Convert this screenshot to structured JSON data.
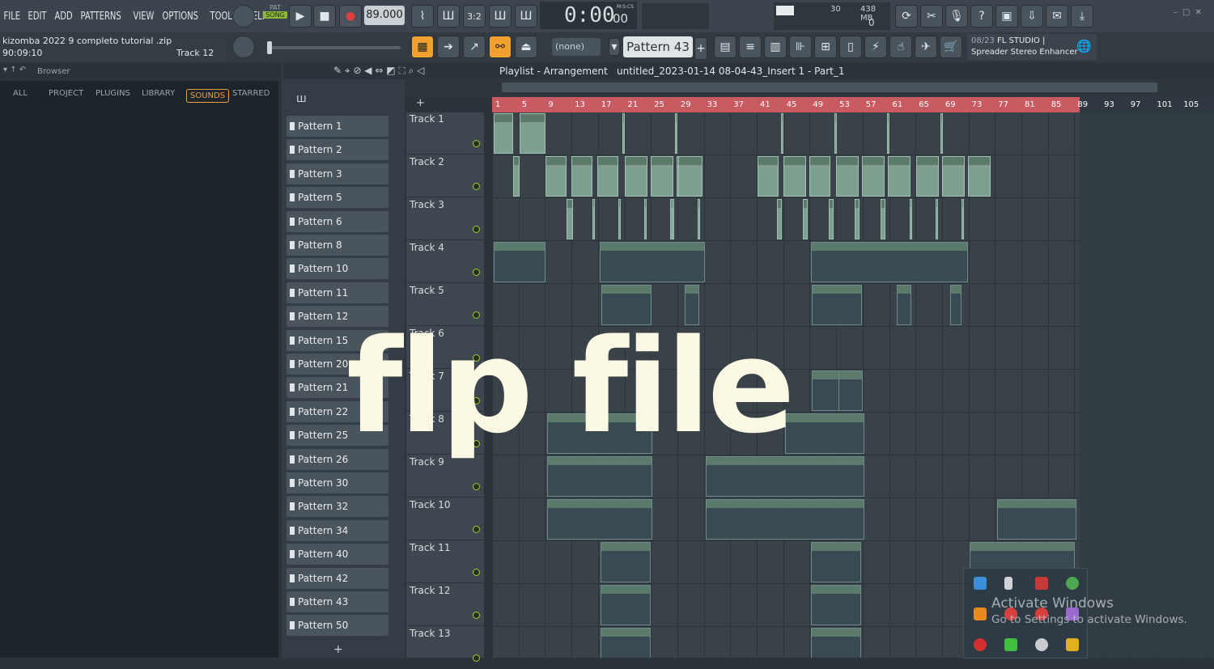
{
  "menu": [
    "FILE",
    "EDIT",
    "ADD",
    "PATTERNS",
    "VIEW",
    "OPTIONS",
    "TOOLS",
    "HELP"
  ],
  "transport": {
    "pat_label": "PAT",
    "song_label": "SONG",
    "tempo": "89.000",
    "time": "0:00",
    "time_small": "00",
    "time_unit": "M:S:CS"
  },
  "perf": {
    "cpu": "30",
    "mem": "438 MB",
    "poly": "0"
  },
  "hint": {
    "project": "kizomba 2022 9 completo  tutorial .zip",
    "time": "90:09:10",
    "target": "Track 12"
  },
  "pattern_select": {
    "none_label": "(none)",
    "pattern": "Pattern 43"
  },
  "news": {
    "date": "08/23",
    "title": "FL STUDIO |",
    "subtitle": "Spreader Stereo Enhancer"
  },
  "browser": {
    "title": "Browser",
    "tabs": [
      "ALL",
      "PROJECT",
      "PLUGINS",
      "LIBRARY",
      "SOUNDS",
      "STARRED"
    ],
    "active_tab": "SOUNDS"
  },
  "playlist": {
    "title": "Playlist - Arrangement",
    "separator": "›",
    "arrangement": "untitled_2023-01-14 08-04-43_Insert 1 - Part_1"
  },
  "patterns": [
    "Pattern 1",
    "Pattern 2",
    "Pattern 3",
    "Pattern 5",
    "Pattern 6",
    "Pattern 8",
    "Pattern 10",
    "Pattern 11",
    "Pattern 12",
    "Pattern 15",
    "Pattern 20",
    "Pattern 21",
    "Pattern 22",
    "Pattern 25",
    "Pattern 26",
    "Pattern 30",
    "Pattern 32",
    "Pattern 34",
    "Pattern 40",
    "Pattern 42",
    "Pattern 43",
    "Pattern 50"
  ],
  "tracks": [
    "Track 1",
    "Track 2",
    "Track 3",
    "Track 4",
    "Track 5",
    "Track 6",
    "Track 7",
    "Track 8",
    "Track 9",
    "Track 10",
    "Track 11",
    "Track 12",
    "Track 13"
  ],
  "ruler": [
    "1",
    "5",
    "9",
    "13",
    "17",
    "21",
    "25",
    "29",
    "33",
    "37",
    "41",
    "45",
    "49",
    "53",
    "57",
    "61",
    "65",
    "69",
    "73",
    "77",
    "81",
    "85",
    "89",
    "93",
    "97",
    "101",
    "105"
  ],
  "overlay": "flp file",
  "watermark": {
    "line1": "Activate Windows",
    "line2": "Go to Settings to activate Windows."
  }
}
